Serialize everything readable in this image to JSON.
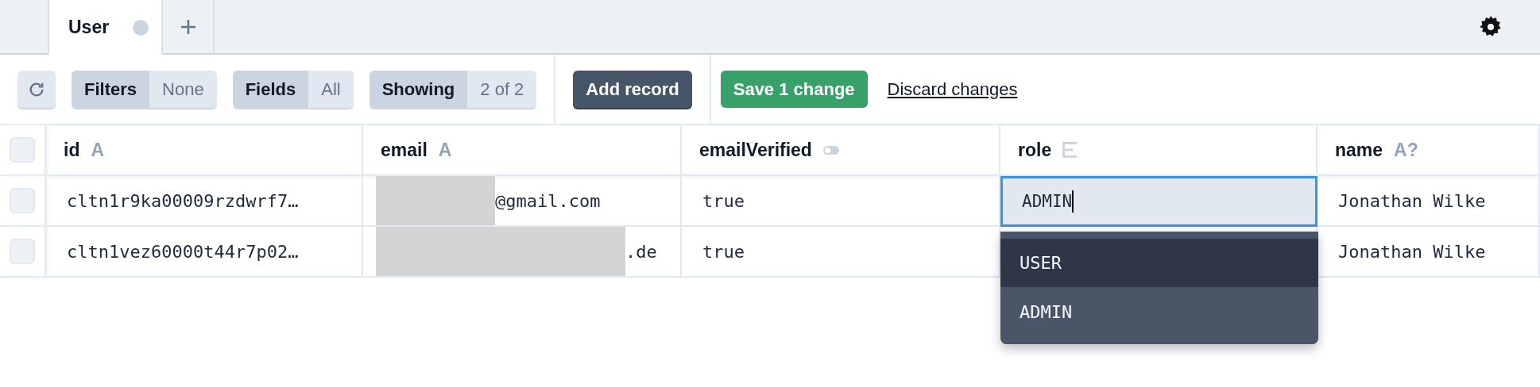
{
  "tabs": [
    {
      "label": "User",
      "selected": true,
      "unsaved": true
    }
  ],
  "toolbar": {
    "filters": {
      "label": "Filters",
      "value": "None"
    },
    "fields": {
      "label": "Fields",
      "value": "All"
    },
    "showing": {
      "label": "Showing",
      "value": "2 of 2"
    },
    "add_record": "Add record",
    "save": "Save 1 change",
    "discard": "Discard changes"
  },
  "table": {
    "select_all": {
      "checked": false
    },
    "columns": [
      {
        "name": "id",
        "kind": "text",
        "type_label": "A"
      },
      {
        "name": "email",
        "kind": "text",
        "type_label": "A"
      },
      {
        "name": "emailVerified",
        "kind": "boolean"
      },
      {
        "name": "role",
        "kind": "enum"
      },
      {
        "name": "name",
        "kind": "text",
        "type_label": "A?"
      }
    ],
    "rows": [
      {
        "checked": false,
        "id": "cltn1r9ka00009rzdwrf7…",
        "email": "@gmail.com",
        "email_redacted": true,
        "emailVerified": "true",
        "role": "ADMIN",
        "name": "Jonathan Wilke"
      },
      {
        "checked": false,
        "id": "cltn1vez60000t44r7p02…",
        "email": ".de",
        "email_redacted": true,
        "emailVerified": "true",
        "name": "Jonathan Wilke"
      }
    ]
  },
  "role_dropdown": {
    "options": [
      {
        "label": "USER",
        "selected": true
      },
      {
        "label": "ADMIN",
        "selected": false
      }
    ]
  }
}
